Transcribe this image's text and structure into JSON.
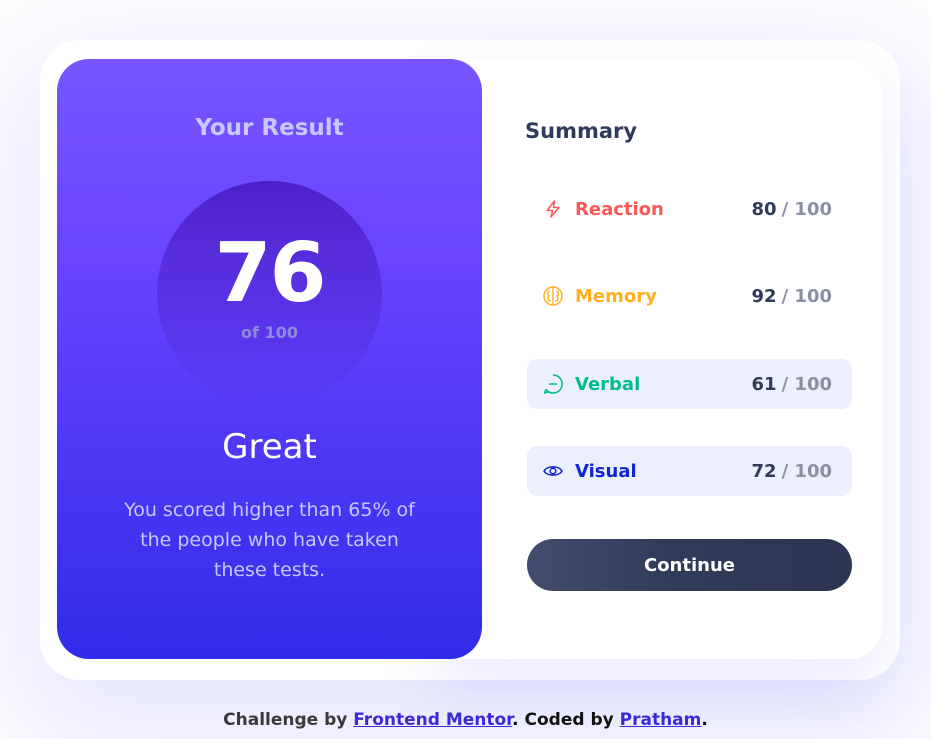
{
  "result": {
    "title": "Your Result",
    "score": "76",
    "score_of": "of 100",
    "rating": "Great",
    "description": "You scored higher than 65% of the people who have taken these tests."
  },
  "summary": {
    "title": "Summary",
    "items": [
      {
        "label": "Reaction",
        "value": "80",
        "max": "/ 100",
        "icon": "lightning-icon",
        "color": "#ff5757"
      },
      {
        "label": "Memory",
        "value": "92",
        "max": "/ 100",
        "icon": "brain-icon",
        "color": "#ffb01f"
      },
      {
        "label": "Verbal",
        "value": "61",
        "max": "/ 100",
        "icon": "chat-bubble-icon",
        "color": "#00bb8f"
      },
      {
        "label": "Visual",
        "value": "72",
        "max": "/ 100",
        "icon": "eye-icon",
        "color": "#1125d4"
      }
    ],
    "continue_label": "Continue"
  },
  "footer": {
    "prefix": "Challenge by ",
    "challenge_link": "Frontend Mentor",
    "middle": ". Coded by ",
    "author_link": "Pratham",
    "suffix": "."
  }
}
